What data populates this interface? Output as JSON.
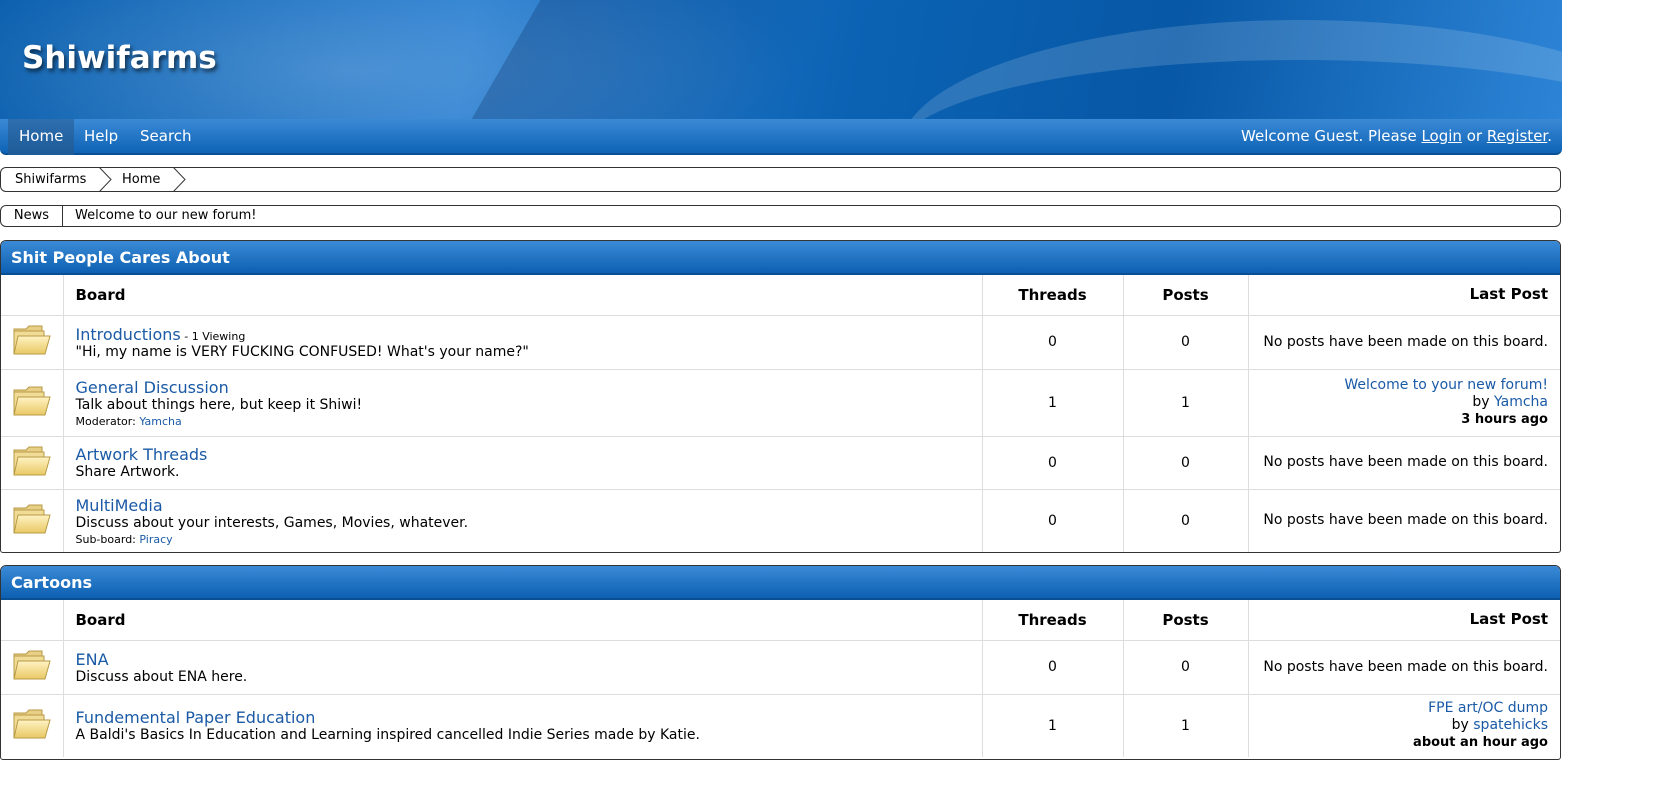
{
  "site": {
    "title": "Shiwifarms"
  },
  "nav": {
    "items": [
      "Home",
      "Help",
      "Search"
    ],
    "welcome_prefix": "Welcome Guest. Please ",
    "login": "Login",
    "or": " or ",
    "register": "Register",
    "suffix": "."
  },
  "breadcrumb": [
    "Shiwifarms",
    "Home"
  ],
  "news": {
    "label": "News",
    "text": "Welcome to our new forum!"
  },
  "columns": {
    "board": "Board",
    "threads": "Threads",
    "posts": "Posts",
    "last_post": "Last Post"
  },
  "icons": {
    "board": "folder-icon",
    "separator": "breadcrumb-arrow-icon"
  },
  "colors": {
    "link": "#1a5aa6",
    "header_blue": "#0d60b2"
  },
  "categories": [
    {
      "title": "Shit People Cares About",
      "boards": [
        {
          "name": "Introductions",
          "viewing": " - 1 Viewing",
          "desc": "\"Hi, my name is VERY FUCKING CONFUSED! What's your name?\"",
          "threads": "0",
          "posts": "0",
          "last_post": "No posts have been made on this board."
        },
        {
          "name": "General Discussion",
          "desc": "Talk about things here, but keep it Shiwi!",
          "extra_label": "Moderator: ",
          "extra_link": "Yamcha",
          "threads": "1",
          "posts": "1",
          "last_title": "Welcome to your new forum!",
          "last_by": "by ",
          "last_user": "Yamcha",
          "last_time": "3 hours ago"
        },
        {
          "name": "Artwork Threads",
          "desc": "Share Artwork.",
          "threads": "0",
          "posts": "0",
          "last_post": "No posts have been made on this board."
        },
        {
          "name": "MultiMedia",
          "desc": "Discuss about your interests, Games, Movies, whatever.",
          "extra_label": "Sub-board: ",
          "extra_link": "Piracy",
          "threads": "0",
          "posts": "0",
          "last_post": "No posts have been made on this board."
        }
      ]
    },
    {
      "title": "Cartoons",
      "boards": [
        {
          "name": "ENA",
          "desc": "Discuss about ENA here.",
          "threads": "0",
          "posts": "0",
          "last_post": "No posts have been made on this board."
        },
        {
          "name": "Fundemental Paper Education",
          "desc": "A Baldi's Basics In Education and Learning inspired cancelled Indie Series made by Katie.",
          "threads": "1",
          "posts": "1",
          "last_title": "FPE art/OC dump",
          "last_by": "by ",
          "last_user": "spatehicks",
          "last_time": "about an hour ago"
        }
      ]
    }
  ]
}
